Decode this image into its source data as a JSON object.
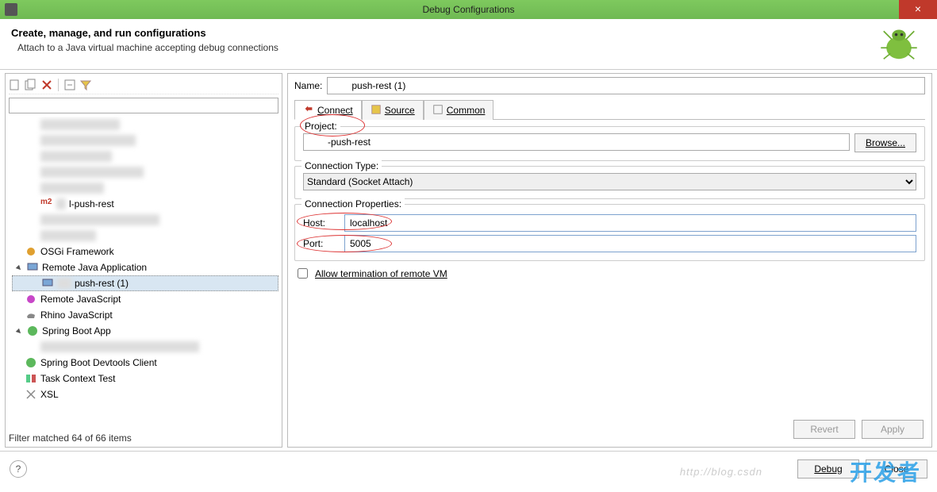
{
  "window": {
    "title": "Debug Configurations",
    "close": "×"
  },
  "header": {
    "title": "Create, manage, and run configurations",
    "subtitle": "Attach to a Java virtual machine accepting debug connections"
  },
  "left": {
    "filter_value": "",
    "items": {
      "maven_push_rest": "l-push-rest",
      "osgi": "OSGi Framework",
      "remote_java": "Remote Java Application",
      "push_rest_cfg": "push-rest (1)",
      "remote_js": "Remote JavaScript",
      "rhino": "Rhino JavaScript",
      "spring_boot": "Spring Boot App",
      "spring_devtools": "Spring Boot Devtools Client",
      "task_ctx": "Task Context Test",
      "xsl": "XSL"
    },
    "filter_status": "Filter matched 64 of 66 items"
  },
  "right": {
    "name_label": "Name:",
    "name_value": "push-rest (1)",
    "tabs": {
      "connect": "Connect",
      "source": "Source",
      "common": "Common"
    },
    "project_label": "Project:",
    "project_value": "-push-rest",
    "browse": "Browse...",
    "ctype_label": "Connection Type:",
    "ctype_value": "Standard (Socket Attach)",
    "cprops_label": "Connection Properties:",
    "host_label": "Host:",
    "host_value": "localhost",
    "port_label": "Port:",
    "port_value": "5005",
    "allow_term": "Allow termination of remote VM"
  },
  "buttons": {
    "revert": "Revert",
    "apply": "Apply",
    "debug": "Debug",
    "close": "Close"
  },
  "watermark": {
    "text": "开发者",
    "url": "http://blog.csdn"
  }
}
